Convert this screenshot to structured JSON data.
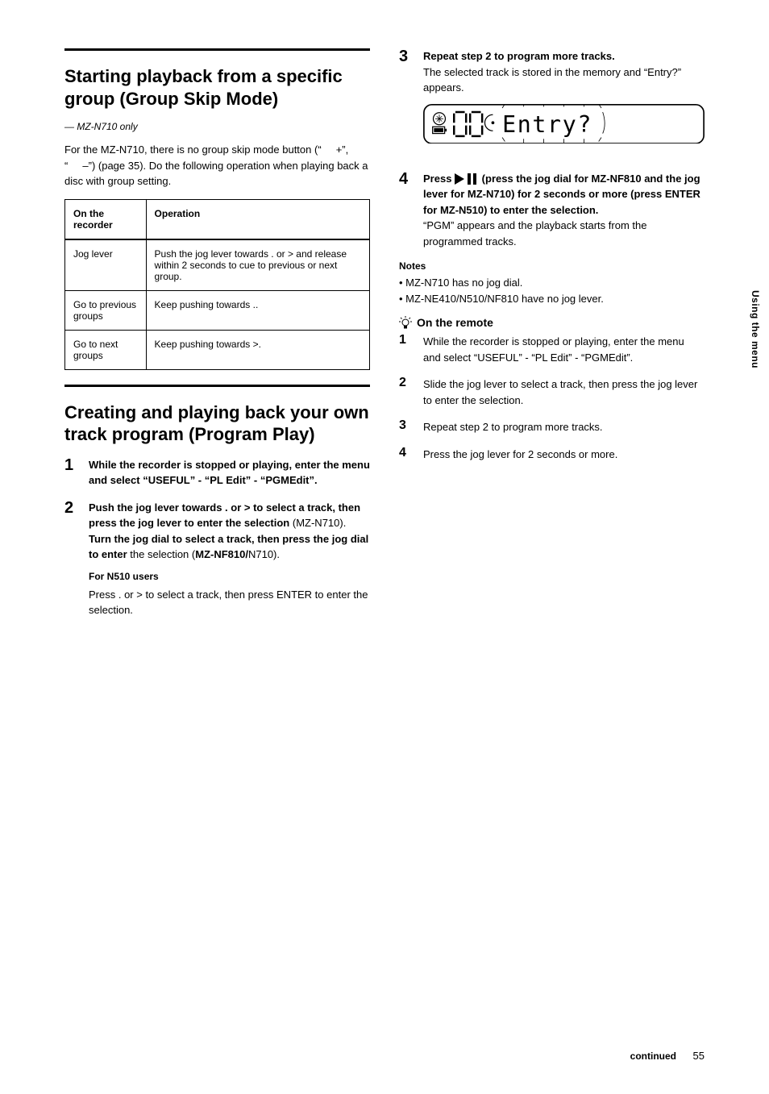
{
  "sideTab": "Using the menu",
  "pageNumber": "55",
  "continued": "continued",
  "left": {
    "section1": {
      "title": "Starting playback from a specific group (Group Skip Mode)",
      "note": "— MZ-N710 only",
      "para1": "For the MZ-N710, there is no group skip mode button (“     +”, “     –”) (page 35). Do the following operation when playing back a disc with group setting.",
      "tableHead1": "On the recorder",
      "tableHead2": "Operation",
      "row1a": "Jog lever",
      "row1b": "Push the jog lever towards . or > and release within 2 seconds to cue to previous or next group.",
      "row2a": "Go to previous groups",
      "row2b": "Keep pushing towards ..",
      "row3a": "Go to next groups",
      "row3b": "Keep pushing towards >."
    },
    "section2": {
      "title": "Creating and playing back your own track program (Program Play)",
      "steps": {
        "s1": "While the recorder is stopped or playing, enter the menu and select “USEFUL” - “PL Edit” - “PGMEdit”.",
        "s2a": "Push the jog lever towards . or > to select a track, then press the jog lever to enter the selection",
        "s2b": "(MZ-N710).",
        "s2c": "Turn the jog dial to select a track, then press the jog dial to enter",
        "s2d": "the selection (",
        "s2e": "MZ-NF810/",
        "s2f": "N710).",
        "s2g": "For N510 users",
        "s2h": "Press . or > to select a track, then press ENTER to enter the selection."
      }
    }
  },
  "right": {
    "steps": {
      "s3a": "Repeat step 2 to program more tracks.",
      "s3b": "The selected track is stored in the memory and “Entry?” appears.",
      "s4a": "Press ",
      "s4b": " (press the jog dial for MZ-NF810 and the jog lever for MZ-N710) for 2 seconds or more (press ENTER for MZ-N510) to enter the selection.",
      "s4c": "“PGM” appears and the playback starts from the programmed tracks."
    },
    "notesHead": "Notes",
    "notes": "• MZ-N710 has no jog dial.\n• MZ-NE410/N510/NF810 have no jog lever.",
    "tipHead": "On the remote",
    "tipSteps": {
      "t1": "While the recorder is stopped or playing, enter the menu and select “USEFUL” - “PL Edit” - “PGMEdit”.",
      "t2": "Slide the jog lever to select a track, then press the jog lever to enter the selection.",
      "t3": "Repeat step 2 to program more tracks.",
      "t4": "Press the jog lever for 2 seconds or more."
    }
  },
  "lcd": {
    "text": "Entry?",
    "digits": "00"
  }
}
